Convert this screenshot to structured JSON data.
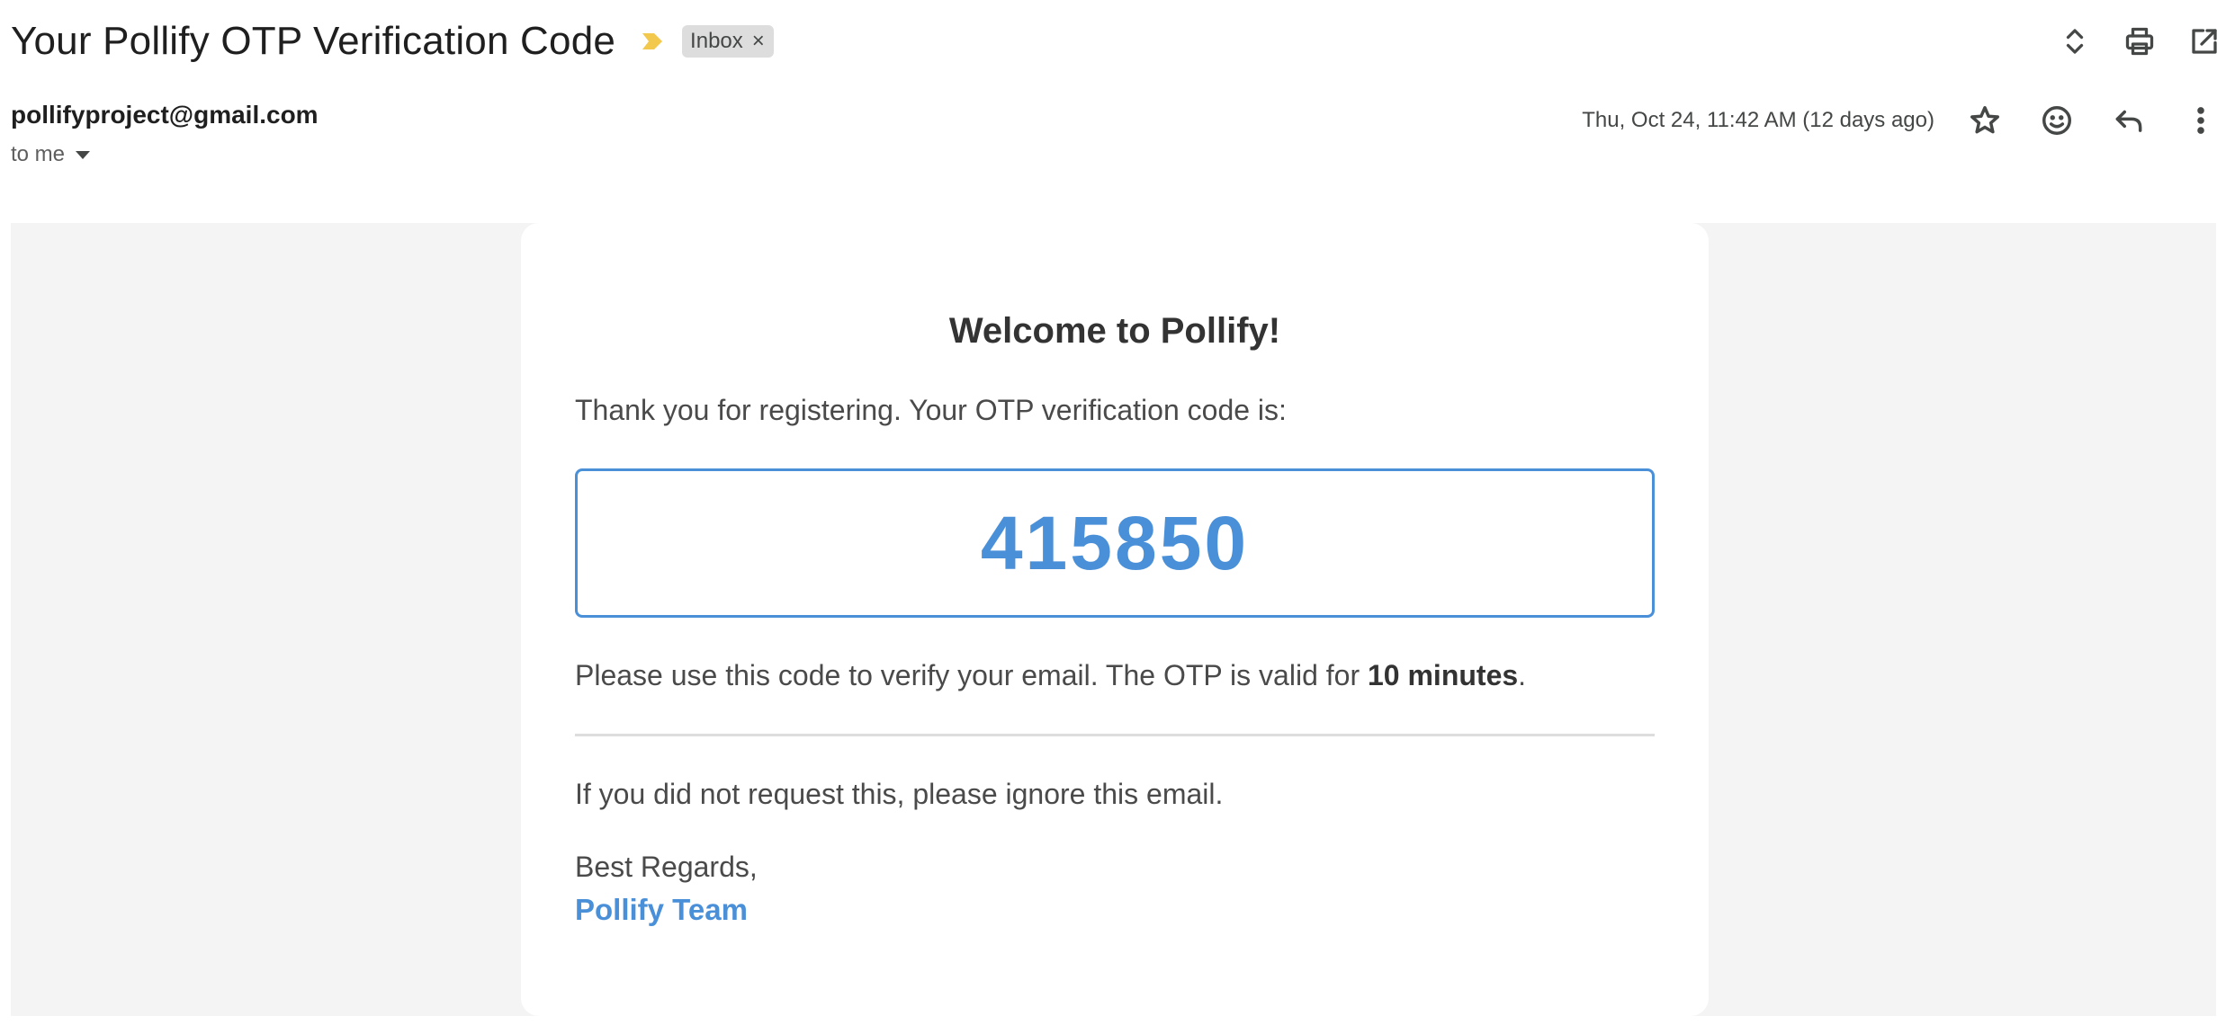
{
  "email": {
    "subject": "Your Pollify OTP Verification Code",
    "label": "Inbox",
    "label_remove": "×",
    "sender": "pollifyproject@gmail.com",
    "recipient": "to me",
    "date": "Thu, Oct 24, 11:42 AM (12 days ago)"
  },
  "icons": {
    "importance": "importance-marker-icon",
    "expand": "expand-collapse-icon",
    "print": "print-icon",
    "open_new": "open-in-new-window-icon",
    "star": "star-icon",
    "emoji": "emoji-reaction-icon",
    "reply": "reply-icon",
    "more": "more-vertical-icon"
  },
  "colors": {
    "accent": "#4a90d9",
    "importance": "#f2c94c",
    "body_bg": "#f4f4f4",
    "chip_bg": "#dddddd"
  },
  "message": {
    "heading": "Welcome to Pollify!",
    "intro": "Thank you for registering. Your OTP verification code is:",
    "otp": "415850",
    "valid_prefix": "Please use this code to verify your email. The OTP is valid for ",
    "valid_bold": "10 minutes",
    "valid_suffix": ".",
    "ignore": "If you did not request this, please ignore this email.",
    "regards": "Best Regards,",
    "team": "Pollify Team"
  }
}
